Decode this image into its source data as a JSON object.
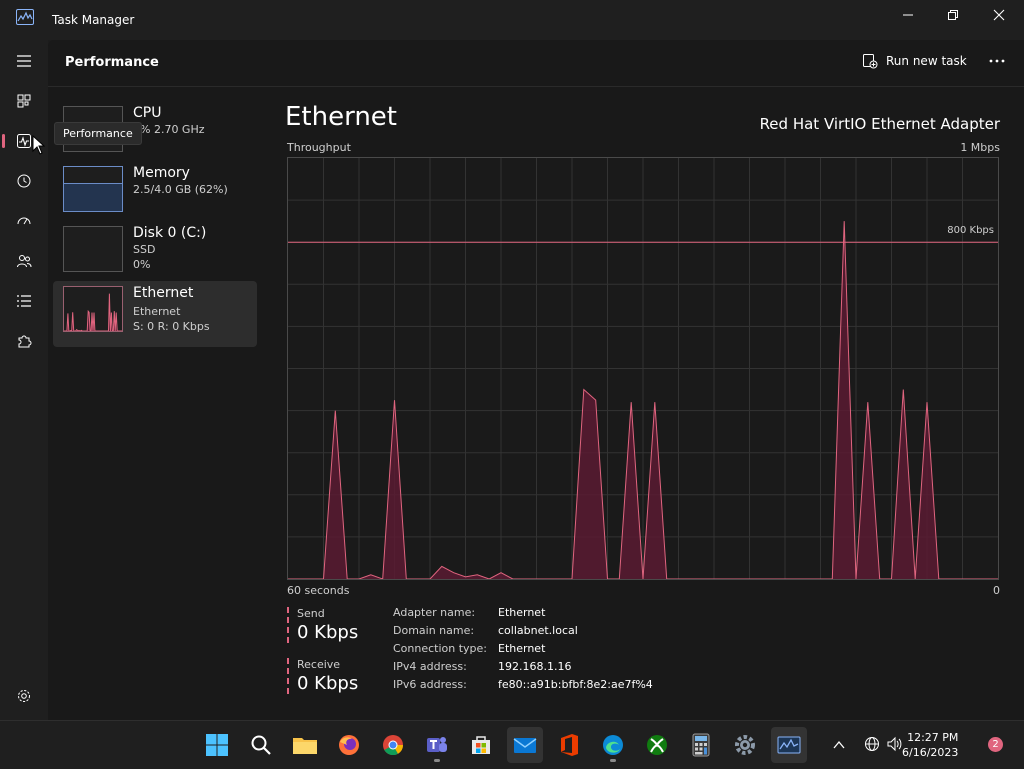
{
  "window": {
    "title": "Task Manager"
  },
  "header": {
    "page_title": "Performance",
    "run_new_task": "Run new task"
  },
  "tooltip": "Performance",
  "devices": [
    {
      "name": "CPU",
      "sub1": "1% 2.70 GHz",
      "sub2": ""
    },
    {
      "name": "Memory",
      "sub1": "2.5/4.0 GB (62%)",
      "sub2": ""
    },
    {
      "name": "Disk 0 (C:)",
      "sub1": "SSD",
      "sub2": "0%"
    },
    {
      "name": "Ethernet",
      "sub1": "Ethernet",
      "sub2": "S: 0 R: 0 Kbps"
    }
  ],
  "detail": {
    "title": "Ethernet",
    "adapter": "Red Hat VirtIO Ethernet Adapter",
    "throughput_label": "Throughput",
    "max_label": "1 Mbps",
    "scale_line_label": "800 Kbps",
    "time_left": "60 seconds",
    "time_right": "0"
  },
  "stats": {
    "send_label": "Send",
    "send_value": "0 Kbps",
    "receive_label": "Receive",
    "receive_value": "0 Kbps"
  },
  "info": [
    {
      "key": "Adapter name:",
      "value": "Ethernet"
    },
    {
      "key": "Domain name:",
      "value": "collabnet.local"
    },
    {
      "key": "Connection type:",
      "value": "Ethernet"
    },
    {
      "key": "IPv4 address:",
      "value": "192.168.1.16"
    },
    {
      "key": "IPv6 address:",
      "value": "fe80::a91b:bfbf:8e2:ae7f%4"
    }
  ],
  "chart_data": {
    "type": "area",
    "x_range": [
      60,
      0
    ],
    "ylim": [
      0,
      1000
    ],
    "y_unit": "Kbps",
    "reference_line": 800,
    "series": [
      {
        "x": [
          60,
          59,
          58,
          57,
          56,
          55,
          54,
          53,
          52,
          51,
          50,
          49,
          48,
          47,
          46,
          45,
          44,
          43,
          42,
          41,
          40,
          39,
          38,
          37,
          36,
          35,
          34,
          33,
          32,
          31,
          30,
          29,
          28,
          27,
          26,
          25,
          24,
          23,
          22,
          21,
          20,
          19,
          18,
          17,
          16,
          15,
          14,
          13,
          12,
          11,
          10,
          9,
          8,
          7,
          6,
          5,
          4,
          3,
          2,
          1,
          0
        ],
        "y": [
          0,
          0,
          0,
          0,
          400,
          0,
          0,
          10,
          0,
          425,
          0,
          0,
          0,
          30,
          15,
          5,
          10,
          0,
          15,
          0,
          0,
          0,
          0,
          0,
          0,
          450,
          425,
          0,
          0,
          420,
          0,
          420,
          0,
          0,
          0,
          0,
          0,
          0,
          0,
          0,
          0,
          0,
          0,
          0,
          0,
          0,
          0,
          850,
          0,
          420,
          0,
          0,
          450,
          0,
          420,
          0,
          0,
          0,
          0,
          0,
          0
        ]
      }
    ]
  },
  "clock": {
    "time": "12:27 PM",
    "date": "6/16/2023"
  },
  "notifications": "2"
}
